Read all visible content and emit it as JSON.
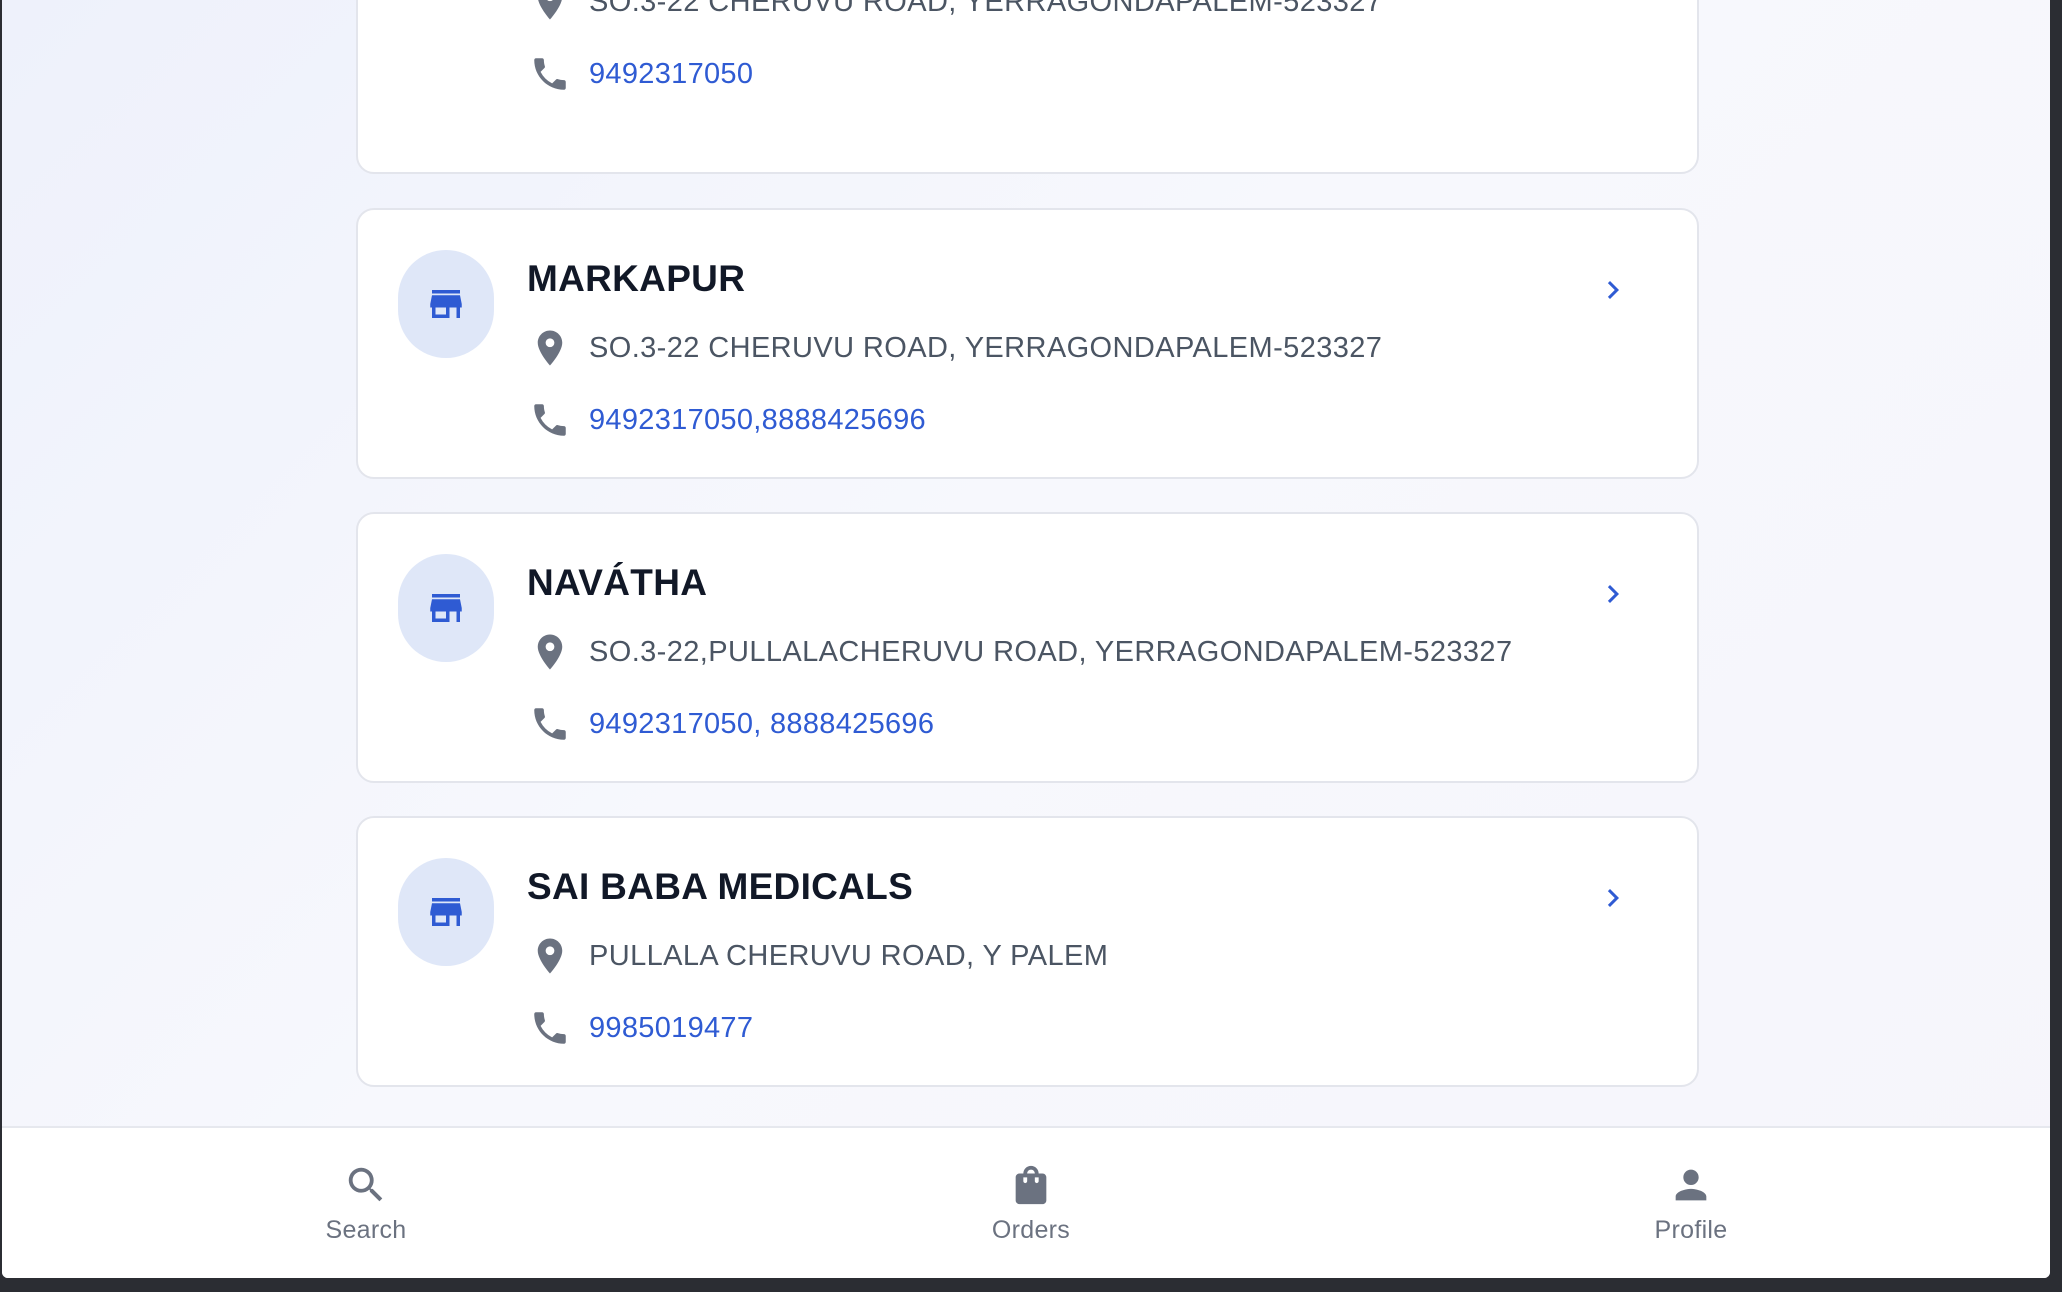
{
  "stores": [
    {
      "name": "",
      "address": "SO.3-22 CHERUVU ROAD, YERRAGONDAPALEM-523327",
      "phone": "9492317050",
      "icon": "store-icon"
    },
    {
      "name": "MARKAPUR",
      "address": "SO.3-22 CHERUVU ROAD, YERRAGONDAPALEM-523327",
      "phone": "9492317050,8888425696",
      "icon": "store-icon"
    },
    {
      "name": "NAVÁTHA",
      "address": "SO.3-22,PULLALACHERUVU ROAD, YERRAGONDAPALEM-523327",
      "phone": "9492317050, 8888425696",
      "icon": "store-icon"
    },
    {
      "name": "SAI BABA MEDICALS",
      "address": "PULLALA CHERUVU ROAD, Y PALEM",
      "phone": "9985019477",
      "icon": "store-icon"
    }
  ],
  "bottom_nav": {
    "items": [
      {
        "label": "Search",
        "icon": "search-icon"
      },
      {
        "label": "Orders",
        "icon": "shopping-bag-icon"
      },
      {
        "label": "Profile",
        "icon": "person-icon"
      }
    ]
  },
  "colors": {
    "accent": "#2f5bd3",
    "avatar_bg": "#dfe7f8",
    "text_primary": "#111827",
    "text_secondary": "#4b5563",
    "icon_gray": "#6b7280"
  }
}
